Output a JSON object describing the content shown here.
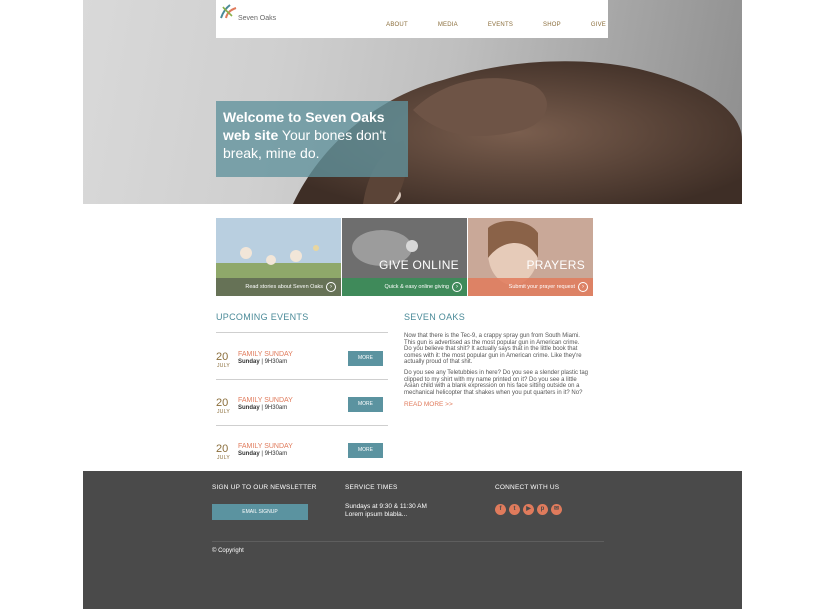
{
  "header": {
    "logo_text": "Seven Oaks",
    "nav": [
      "ABOUT",
      "MEDIA",
      "EVENTS",
      "SHOP",
      "GIVE"
    ]
  },
  "hero": {
    "welcome_bold": "Welcome to Seven Oaks web site",
    "welcome_rest": "Your bones don't break, mine do."
  },
  "tiles": [
    {
      "title": "",
      "caption": "Read stories about Seven Oaks"
    },
    {
      "title": "GIVE ONLINE",
      "caption": "Quick & easy online giving"
    },
    {
      "title": "PRAYERS",
      "caption": "Submit your prayer request"
    }
  ],
  "events": {
    "title": "UPCOMING EVENTS",
    "items": [
      {
        "day": "20",
        "month": "JULY",
        "name": "FAMILY SUNDAY",
        "weekday": "Sunday",
        "time": "| 9H30am",
        "button": "MORE"
      },
      {
        "day": "20",
        "month": "JULY",
        "name": "FAMILY SUNDAY",
        "weekday": "Sunday",
        "time": "| 9H30am",
        "button": "MORE"
      },
      {
        "day": "20",
        "month": "JULY",
        "name": "FAMILY SUNDAY",
        "weekday": "Sunday",
        "time": "| 9H30am",
        "button": "MORE"
      }
    ]
  },
  "about": {
    "title": "SEVEN OAKS",
    "p1_lines": [
      "Now that there is the Tec-9, a crappy spray gun from South Miami.",
      "This gun is advertised as the most popular gun in American crime.",
      "Do you believe that shit? It actually says that in the little book that",
      "comes with it: the most popular gun in American crime. Like they're",
      "actually proud of that shit."
    ],
    "p2_lines": [
      "Do you see any Teletubbies in here? Do you see a slender plastic tag",
      "clipped to my shirt with my name printed on it? Do you see a little",
      "Asian child with a blank expression on his face sitting outside on a",
      "mechanical helicopter that shakes when you put quarters in it? No?"
    ],
    "read_more": "READ MORE >>"
  },
  "footer": {
    "newsletter_title": "SIGN UP TO OUR NEWSLETTER",
    "email_button": "EMAIL SIGNUP",
    "service_title": "SERVICE TIMES",
    "service_line1": "Sundays at 9:30 & 11:30 AM",
    "service_line2": "Lorem ipsum blabla...",
    "connect_title": "CONNECT WITH US",
    "socials": [
      {
        "icon": "facebook-icon",
        "glyph": "f"
      },
      {
        "icon": "twitter-icon",
        "glyph": "t"
      },
      {
        "icon": "youtube-icon",
        "glyph": "▶"
      },
      {
        "icon": "pinterest-icon",
        "glyph": "p"
      },
      {
        "icon": "email-icon",
        "glyph": "✉"
      }
    ],
    "copyright": "© Copyright"
  },
  "colors": {
    "accent_teal": "#5b93a0",
    "accent_orange": "#e07b5c",
    "footer_bg": "#4a4a4a"
  }
}
